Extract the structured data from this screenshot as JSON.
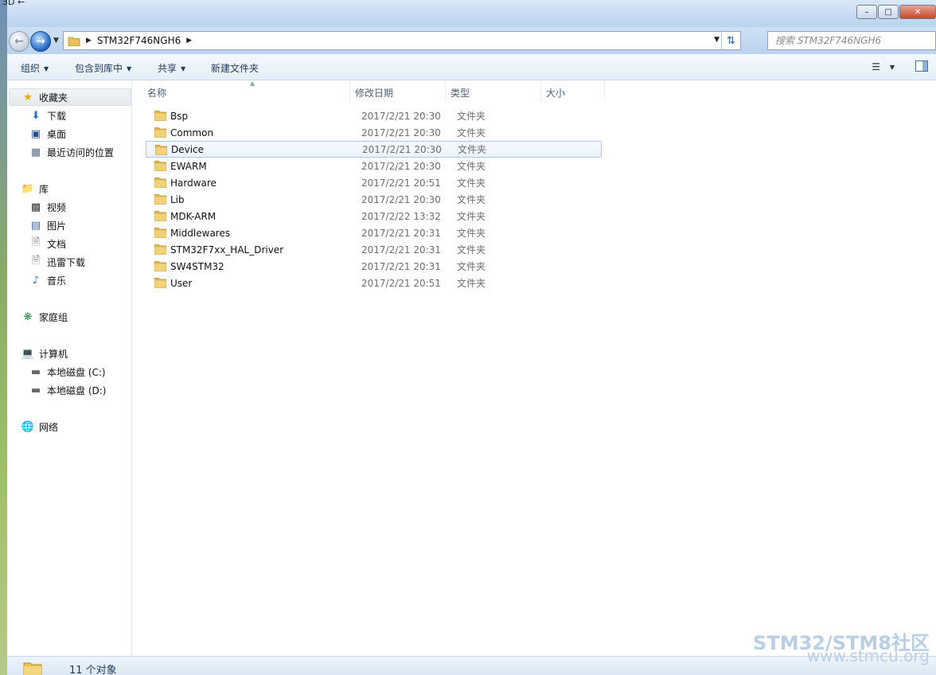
{
  "window": {
    "title_fragment": "3D ←",
    "controls": {
      "minimize": "–",
      "maximize": "□",
      "close": "✕"
    }
  },
  "nav": {
    "breadcrumb": [
      "STM32F746NGH6"
    ],
    "search_placeholder": "搜索 STM32F746NGH6"
  },
  "toolbar": {
    "organize": "组织",
    "include_library": "包含到库中",
    "share": "共享",
    "new_folder": "新建文件夹"
  },
  "sidebar": {
    "favorites": "收藏夹",
    "downloads": "下载",
    "desktop": "桌面",
    "recent": "最近访问的位置",
    "libraries": "库",
    "videos": "视频",
    "pictures": "图片",
    "documents": "文档",
    "xunlei": "迅雷下载",
    "music": "音乐",
    "homegroup": "家庭组",
    "computer": "计算机",
    "disk_c": "本地磁盘 (C:)",
    "disk_d": "本地磁盘 (D:)",
    "network": "网络"
  },
  "columns": {
    "name": "名称",
    "modified": "修改日期",
    "type": "类型",
    "size": "大小"
  },
  "files": [
    {
      "name": "Bsp",
      "date": "2017/2/21 20:30",
      "type": "文件夹"
    },
    {
      "name": "Common",
      "date": "2017/2/21 20:30",
      "type": "文件夹"
    },
    {
      "name": "Device",
      "date": "2017/2/21 20:30",
      "type": "文件夹"
    },
    {
      "name": "EWARM",
      "date": "2017/2/21 20:30",
      "type": "文件夹"
    },
    {
      "name": "Hardware",
      "date": "2017/2/21 20:51",
      "type": "文件夹"
    },
    {
      "name": "Lib",
      "date": "2017/2/21 20:30",
      "type": "文件夹"
    },
    {
      "name": "MDK-ARM",
      "date": "2017/2/22 13:32",
      "type": "文件夹"
    },
    {
      "name": "Middlewares",
      "date": "2017/2/21 20:31",
      "type": "文件夹"
    },
    {
      "name": "STM32F7xx_HAL_Driver",
      "date": "2017/2/21 20:31",
      "type": "文件夹"
    },
    {
      "name": "SW4STM32",
      "date": "2017/2/21 20:31",
      "type": "文件夹"
    },
    {
      "name": "User",
      "date": "2017/2/21 20:51",
      "type": "文件夹"
    }
  ],
  "status": {
    "count": "11 个对象"
  },
  "watermark": {
    "line1": "STM32/STM8社区",
    "line2": "www.stmcu.org"
  },
  "colors": {
    "accent": "#1f64c2",
    "highlight_border": "#a9c8ea",
    "watermark": "#b8cfe4"
  }
}
